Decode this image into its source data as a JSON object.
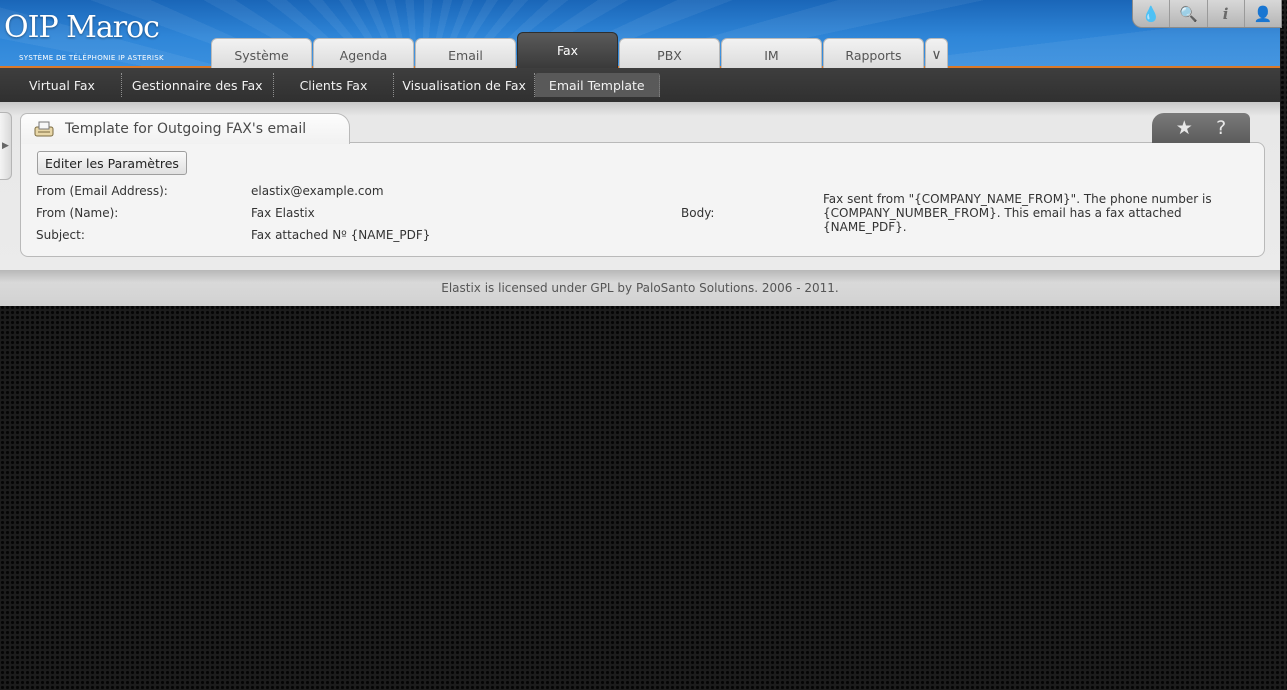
{
  "logo": {
    "main": "OIP Maroc",
    "sub": "SYSTÈME DE TÉLÉPHONIE IP ASTERISK"
  },
  "top_icons": [
    "drop-icon",
    "magnifier-icon",
    "info-icon",
    "user-icon"
  ],
  "tabs": [
    {
      "label": "Système"
    },
    {
      "label": "Agenda"
    },
    {
      "label": "Email"
    },
    {
      "label": "Fax",
      "active": true
    },
    {
      "label": "PBX"
    },
    {
      "label": "IM"
    },
    {
      "label": "Rapports"
    }
  ],
  "subnav": [
    {
      "label": "Virtual Fax"
    },
    {
      "label": "Gestionnaire des Fax"
    },
    {
      "label": "Clients Fax"
    },
    {
      "label": "Visualisation de Fax"
    },
    {
      "label": "Email Template",
      "active": true
    }
  ],
  "panel": {
    "title": "Template for Outgoing FAX's email",
    "tools": {
      "star": "★",
      "help": "?"
    },
    "edit_button": "Editer les Paramètres"
  },
  "fields": {
    "from_email_label": "From (Email Address):",
    "from_email_value": "elastix@example.com",
    "from_name_label": "From (Name):",
    "from_name_value": "Fax Elastix",
    "subject_label": "Subject:",
    "subject_value": "Fax attached Nº {NAME_PDF}",
    "body_label": "Body:",
    "body_value": "Fax sent from \"{COMPANY_NAME_FROM}\". The phone number is {COMPANY_NUMBER_FROM}. This email has a fax attached {NAME_PDF}."
  },
  "footer": {
    "text": "Elastix is licensed under GPL by PaloSanto Solutions. 2006 - 2011."
  },
  "colors": {
    "header_blue": "#2f86d8",
    "accent_orange": "#d9792a",
    "subnav_dark": "#363636"
  }
}
